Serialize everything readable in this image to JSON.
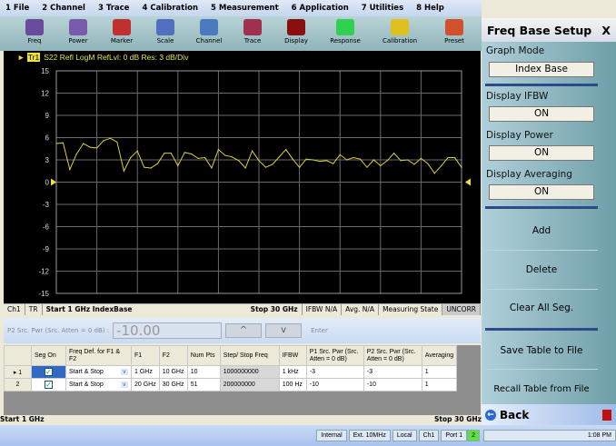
{
  "menu": [
    "1 File",
    "2 Channel",
    "3 Trace",
    "4 Calibration",
    "5 Measurement",
    "6 Application",
    "7 Utilities",
    "8 Help"
  ],
  "toolbar": [
    {
      "label": "Freq",
      "icon": "freq-icon",
      "color": "#6a4a9a"
    },
    {
      "label": "Power",
      "icon": "power-icon",
      "color": "#7a5aaa"
    },
    {
      "label": "Marker",
      "icon": "marker-icon",
      "color": "#c03030"
    },
    {
      "label": "Scale",
      "icon": "scale-icon",
      "color": "#5070c0"
    },
    {
      "label": "Channel",
      "icon": "channel-icon",
      "color": "#4a7ac0"
    },
    {
      "label": "Trace",
      "icon": "trace-icon",
      "color": "#a03050"
    },
    {
      "label": "Display",
      "icon": "display-icon",
      "color": "#8a1010"
    },
    {
      "label": "Response",
      "icon": "response-icon",
      "color": "#30d050"
    },
    {
      "label": "Calibration",
      "icon": "wrench-icon",
      "color": "#e0c020"
    },
    {
      "label": "Preset",
      "icon": "home-icon",
      "color": "#d05030"
    }
  ],
  "trace_header": {
    "tag": "Tr1",
    "text": "S22 Refl LogM RefLvl: 0  dB Res: 3  dB/Div"
  },
  "chart_data": {
    "type": "line",
    "ylim": [
      -15,
      15
    ],
    "yticks": [
      "15",
      "12",
      "9",
      "6",
      "3",
      "0",
      "-3",
      "-6",
      "-9",
      "-12",
      "-15"
    ],
    "xlim": [
      0,
      60
    ],
    "grid": true,
    "trace_color": "#d8d040",
    "reference_level": 0,
    "values": [
      5.2,
      5.3,
      1.7,
      3.8,
      5.2,
      4.7,
      4.6,
      5.6,
      5.9,
      5.4,
      1.5,
      3.3,
      4.2,
      2.0,
      1.9,
      2.5,
      3.9,
      3.9,
      2.2,
      4.0,
      3.8,
      3.2,
      3.3,
      1.9,
      4.4,
      3.6,
      3.4,
      2.9,
      1.9,
      4.2,
      2.9,
      2.0,
      2.4,
      3.4,
      4.4,
      3.1,
      2.0,
      3.1,
      3.0,
      2.8,
      2.9,
      2.5,
      3.7,
      3.0,
      3.3,
      3.1,
      2.0,
      3.0,
      2.2,
      2.9,
      3.9,
      2.9,
      3.0,
      2.4,
      3.2,
      2.5,
      1.2,
      2.2,
      3.3,
      3.3,
      2.0
    ]
  },
  "channel_status": {
    "ch": "Ch1",
    "tr": "TR",
    "start": "Start 1 GHz  IndexBase",
    "stop": "Stop 30 GHz",
    "ifbw": "IFBW N/A",
    "avg": "Avg. N/A",
    "state": "Measuring State",
    "corr": "UNCORR"
  },
  "power_entry": {
    "label": "P2 Src. Pwr  (Src. Atten = 0 dB)  :",
    "value": "-10.00",
    "up": "^",
    "down": "v",
    "enter": "Enter"
  },
  "table": {
    "headers": [
      "",
      "Seg On",
      "Freq Def. for F1 & F2",
      "F1",
      "F2",
      "Num Pts",
      "Step/ Stop Freq",
      "IFBW",
      "P1 Src. Pwr  (Src. Atten = 0 dB)",
      "P2 Src. Pwr  (Src. Atten = 0 dB)",
      "Averaging"
    ],
    "rows": [
      {
        "n": "1",
        "def": "Start & Stop",
        "f1": "1 GHz",
        "f2": "10 GHz",
        "pts": "10",
        "step": "1000000000",
        "ifbw": "1 kHz",
        "p1": "-3",
        "p2": "-3",
        "avg": "1"
      },
      {
        "n": "2",
        "def": "Start & Stop",
        "f1": "20 GHz",
        "f2": "30 GHz",
        "pts": "51",
        "step": "200000000",
        "ifbw": "100 Hz",
        "p1": "-10",
        "p2": "-10",
        "avg": "1"
      }
    ]
  },
  "footer": {
    "start": "Start 1 GHz",
    "stop": "Stop 30 GHz"
  },
  "statusbar": [
    "Internal",
    "Ext. 10MHz",
    "Local",
    "Ch1",
    "Port  1",
    "2"
  ],
  "panel": {
    "title": "Freq Base Setup",
    "close": "X",
    "graph_mode_label": "Graph Mode",
    "graph_mode": "Index Base",
    "ifbw_label": "Display IFBW",
    "ifbw": "ON",
    "power_label": "Display Power",
    "power": "ON",
    "avg_label": "Display Averaging",
    "avg": "ON",
    "add": "Add",
    "delete": "Delete",
    "clear": "Clear All Seg.",
    "save": "Save Table to File",
    "recall": "Recall Table from File",
    "back": "Back"
  },
  "time": "1:08 PM"
}
